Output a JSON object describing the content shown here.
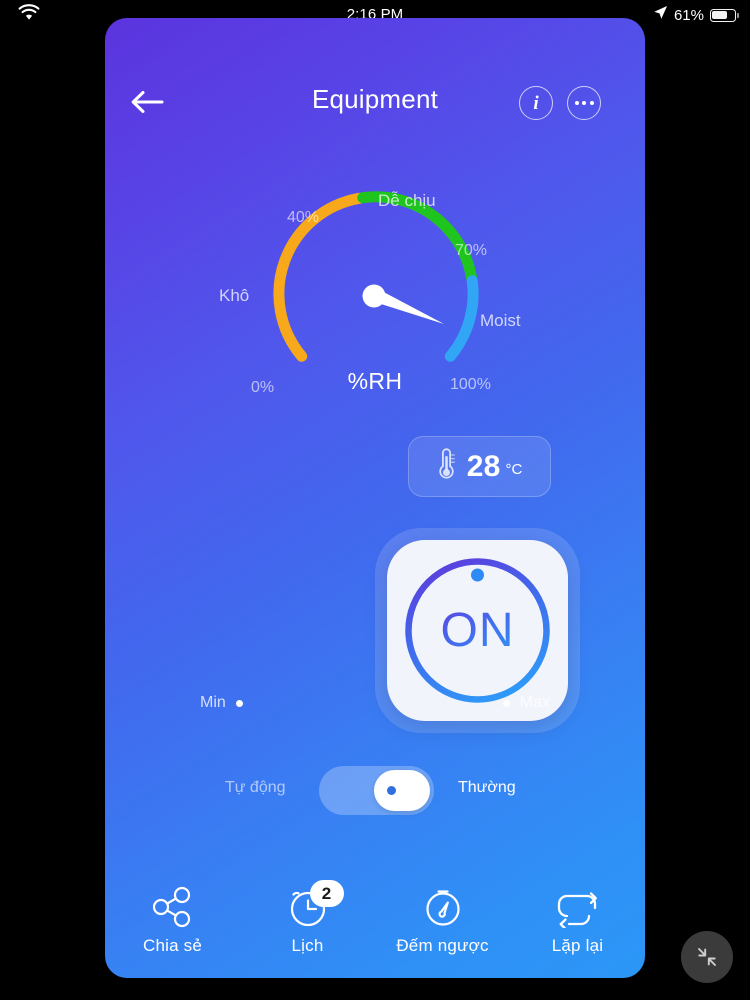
{
  "status_bar": {
    "wifi_icon": "wifi-icon",
    "time": "2:16 PM",
    "location_icon": "location-arrow-icon",
    "battery_percent": "61%",
    "battery_icon": "battery-icon"
  },
  "header": {
    "back_icon": "back-arrow-icon",
    "title": "Equipment",
    "info_label": "i",
    "info_icon": "info-circle-icon",
    "more_icon": "more-options-icon"
  },
  "gauge": {
    "unit_label": "%RH",
    "ticks": {
      "min": "0%",
      "low": "40%",
      "high": "70%",
      "max": "100%"
    },
    "zones": [
      {
        "name": "Khô",
        "label": "Khô",
        "from": 0,
        "to": 40,
        "color": "#F7A81B"
      },
      {
        "name": "Dễ chịu",
        "label": "Dễ chịu",
        "from": 40,
        "to": 70,
        "color": "#1FC41F"
      },
      {
        "name": "Moist",
        "label": "Moist",
        "from": 70,
        "to": 100,
        "color": "#30A6F5"
      }
    ],
    "needle_icon": "gauge-needle-icon"
  },
  "temperature": {
    "icon": "thermometer-icon",
    "value": "28",
    "unit": "°C"
  },
  "power": {
    "state_label": "ON",
    "indicator_icon": "power-dot-icon"
  },
  "range": {
    "min_label": "Min",
    "max_label": "Max"
  },
  "mode": {
    "left_label": "Tự động",
    "right_label": "Thường",
    "toggle_state": "right"
  },
  "nav": {
    "items": [
      {
        "label": "Chia sẻ",
        "icon": "share-icon",
        "badge": ""
      },
      {
        "label": "Lịch",
        "icon": "clock-alarm-icon",
        "badge": "2"
      },
      {
        "label": "Đếm ngược",
        "icon": "timer-icon",
        "badge": ""
      },
      {
        "label": "Lặp lại",
        "icon": "repeat-icon",
        "badge": ""
      }
    ]
  },
  "floating": {
    "shrink_icon": "shrink-screen-icon"
  },
  "colors": {
    "bg_start": "#5B34DE",
    "bg_end": "#2C97F7",
    "dry": "#F7A81B",
    "comfort": "#1FC41F",
    "moist": "#30A6F5"
  }
}
